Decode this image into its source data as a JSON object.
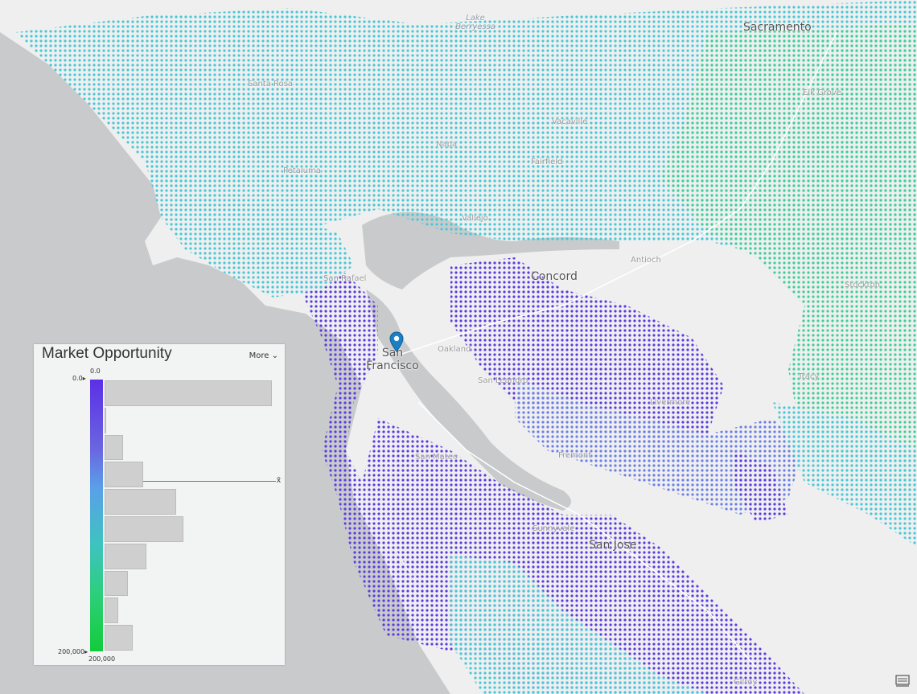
{
  "map": {
    "cities": [
      {
        "name": "Sacramento",
        "major": true
      },
      {
        "name": "Lake Berryessa",
        "water": true
      },
      {
        "name": "Santa Rosa"
      },
      {
        "name": "Elk Grove"
      },
      {
        "name": "Vacaville"
      },
      {
        "name": "Napa"
      },
      {
        "name": "Fairfield"
      },
      {
        "name": "Petaluma"
      },
      {
        "name": "Vallejo"
      },
      {
        "name": "Antioch"
      },
      {
        "name": "Concord",
        "major": true
      },
      {
        "name": "Stockton"
      },
      {
        "name": "San Rafael"
      },
      {
        "name": "Oakland"
      },
      {
        "name": "San Francisco",
        "major": true
      },
      {
        "name": "San Leandro"
      },
      {
        "name": "Tracy"
      },
      {
        "name": "Livermore"
      },
      {
        "name": "San Mateo"
      },
      {
        "name": "Fremont"
      },
      {
        "name": "Sunnyvale"
      },
      {
        "name": "San Jose",
        "major": true
      },
      {
        "name": "Gilroy"
      }
    ],
    "colors": {
      "water": "#c8cacc",
      "land": "#efefef",
      "low": "#5b30e6",
      "mid": "#3fc2c2",
      "high": "#12cc3a"
    },
    "marker_icon": "map-pin-icon"
  },
  "legend": {
    "title": "Market Opportunity",
    "more_label": "More",
    "more_icon": "chevron-down-icon",
    "top_tick_left": "0.0",
    "top_tick_right": "0.0",
    "bottom_tick_left": "200,000",
    "bottom_tick_right": "200,000",
    "mean_label": "x̄",
    "histogram": [
      100,
      0.5,
      11,
      23,
      43,
      47,
      25,
      14,
      8,
      17
    ]
  },
  "toolbar": {
    "corner_icon": "basemap-icon"
  }
}
